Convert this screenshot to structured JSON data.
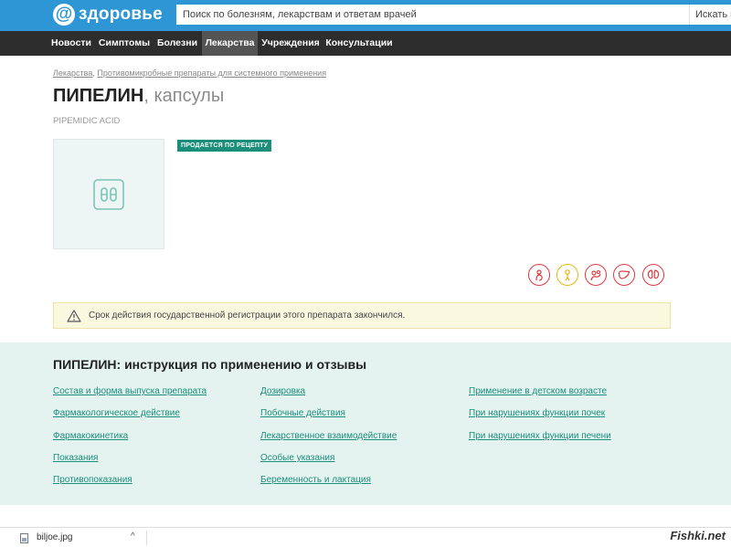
{
  "header": {
    "logo_at": "@",
    "logo_text": "здоровье",
    "search_placeholder": "Поиск по болезням, лекарствам и ответам врачей",
    "search_button": "Искать в"
  },
  "nav": {
    "items": [
      {
        "label": "Новости"
      },
      {
        "label": "Симптомы"
      },
      {
        "label": "Болезни"
      },
      {
        "label": "Лекарства",
        "active": true
      },
      {
        "label": "Учреждения"
      },
      {
        "label": "Консультации"
      }
    ]
  },
  "breadcrumb": {
    "item1": "Лекарства",
    "separator": ",",
    "item2": "Противомикробные препараты для системного применения"
  },
  "drug": {
    "name": "ПИПЕЛИН",
    "form": ", капсулы",
    "substance": "PIPEMIDIC ACID",
    "rx_badge": "ПРОДАЕТСЯ ПО РЕЦЕПТУ"
  },
  "warning_icons": [
    {
      "name": "pregnancy-icon",
      "color": "#e0393e"
    },
    {
      "name": "child-icon",
      "color": "#e8b511"
    },
    {
      "name": "breastfeeding-icon",
      "color": "#e0393e"
    },
    {
      "name": "liver-icon",
      "color": "#e0393e"
    },
    {
      "name": "kidney-icon",
      "color": "#e0393e"
    }
  ],
  "notice": {
    "text": "Срок действия государственной регистрации этого препарата закончился."
  },
  "instructions": {
    "title": "ПИПЕЛИН: инструкция по применению и отзывы",
    "col1": [
      "Состав и форма выпуска препарата",
      "Фармакологическое действие",
      "Фармакокинетика",
      "Показания",
      "Противопоказания"
    ],
    "col2": [
      "Дозировка",
      "Побочные действия",
      "Лекарственное взаимодействие",
      "Особые указания",
      "Беременность и лактация"
    ],
    "col3": [
      "Применение в детском возрасте",
      "При нарушениях функции почек",
      "При нарушениях функции печени"
    ]
  },
  "download_bar": {
    "filename": "biljoe.jpg",
    "chevron": "^",
    "watermark": "Fishki.net"
  },
  "colors": {
    "header_blue": "#2e96d4",
    "nav_dark": "#2d2d2d",
    "accent_green": "#1a8e7a",
    "warning_red": "#e0393e",
    "warning_yellow": "#e8b511"
  }
}
